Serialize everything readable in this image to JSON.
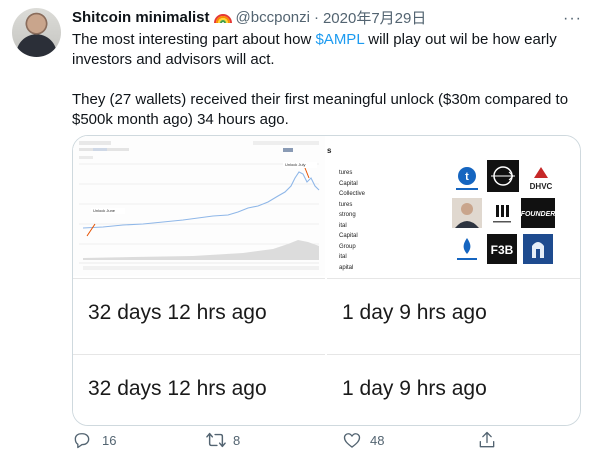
{
  "tweet": {
    "display_name": "Shitcoin minimalist",
    "handle": "@bccponzi",
    "separator": "·",
    "date": "2020年7月29日",
    "more": "···",
    "text_before_cashtag": "The most interesting part about how ",
    "cashtag": "$AMPL",
    "text_after_cashtag": " will play out wil be how early investors and advisors will act.",
    "text_para2": "They (27 wallets) received their first meaningful unlock ($30m compared to $500k month ago) 34 hours ago."
  },
  "media": {
    "chart_labels": {
      "unlock_june": "Unlock June",
      "unlock_july": "Unlock July"
    },
    "investor_names": [
      "tures",
      "Capital",
      "Collective",
      "tures",
      "strong",
      "ital",
      "Capital",
      "Group",
      "ital",
      "apital"
    ],
    "investor_logos": [
      "Stone ventures",
      "crosshair-logo",
      "DHVC",
      "person-photo",
      "Maven",
      "FOUNDER",
      "Huobi Capital",
      "FBG",
      "helmet-logo"
    ],
    "unlock_times": [
      "32 days 12 hrs ago",
      "1 day 9 hrs ago",
      "32 days 12 hrs ago",
      "1 day 9 hrs ago"
    ]
  },
  "actions": {
    "reply_count": "16",
    "retweet_count": "8",
    "like_count": "48",
    "icons": [
      "reply-icon",
      "retweet-icon",
      "like-icon",
      "share-icon"
    ]
  },
  "colors": {
    "link": "#1d9bf0",
    "secondary_text": "#536471",
    "border": "#cfd9de"
  }
}
